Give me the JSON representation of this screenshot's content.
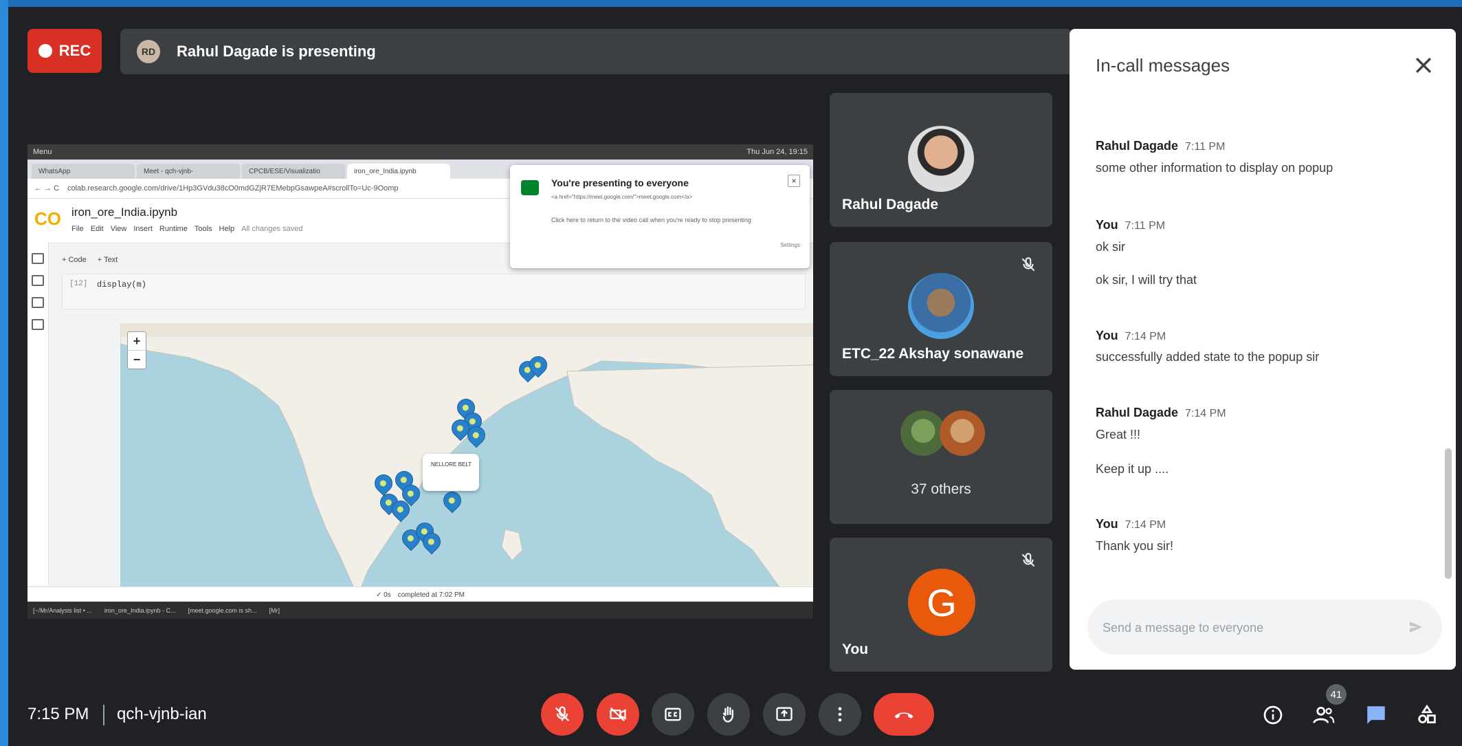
{
  "recording": {
    "label": "REC"
  },
  "presenter_banner": {
    "text": "Rahul Dagade is presenting"
  },
  "shared_screen": {
    "os_menu": "Menu",
    "clock": "Thu Jun 24, 19:15",
    "tabs": [
      "WhatsApp",
      "Meet - qch-vjnb-",
      "CPCB/ESE/Visualizatio",
      "iron_ore_India.ipynb"
    ],
    "address": "colab.research.google.com/drive/1Hp3GVdu38cO0mdGZjR7EMebpGsawpeA#scrollTo=Uc-9Oomp",
    "notebook_name": "iron_ore_India.ipynb",
    "menu": [
      "File",
      "Edit",
      "View",
      "Insert",
      "Runtime",
      "Tools",
      "Help"
    ],
    "saved_status": "All changes saved",
    "toolbar": [
      "+ Code",
      "+ Text"
    ],
    "cell_number": "[12]",
    "cell_code": "display(m)",
    "popup_text": "NELLORE BELT",
    "notification": {
      "title": "You're presenting to everyone",
      "line": "<a href=\"https://meet.google.com/\">meet.google.com</a>",
      "body": "Click here to return to the video call when you're ready to stop presenting",
      "settings": "Settings"
    },
    "status": {
      "check": "✓ 0s",
      "completed": "completed at 7:02 PM"
    },
    "taskbar": [
      "[~/Mr/Analysis list • ...",
      "iron_ore_India.ipynb - C...",
      "[meet.google.com is sh...",
      "[Mr]"
    ]
  },
  "participants": [
    {
      "name": "Rahul Dagade",
      "muted": false
    },
    {
      "name": "ETC_22 Akshay sonawane",
      "muted": true
    },
    {
      "name": "37 others",
      "muted": false
    },
    {
      "name": "You",
      "initial": "G",
      "muted": true
    }
  ],
  "chat": {
    "title": "In-call messages",
    "messages": [
      {
        "sender": "Rahul Dagade",
        "time": "7:11 PM",
        "lines": [
          "some other information to display on popup"
        ]
      },
      {
        "sender": "You",
        "time": "7:11 PM",
        "lines": [
          "ok sir",
          "ok sir, I will try that"
        ]
      },
      {
        "sender": "You",
        "time": "7:14 PM",
        "lines": [
          "successfully added state to the popup sir"
        ]
      },
      {
        "sender": "Rahul Dagade",
        "time": "7:14 PM",
        "lines": [
          "Great !!!",
          "Keep it up ...."
        ]
      },
      {
        "sender": "You",
        "time": "7:14 PM",
        "lines": [
          "Thank you sir!"
        ]
      }
    ],
    "input_placeholder": "Send a message to everyone"
  },
  "bottom_bar": {
    "time": "7:15 PM",
    "meeting_code": "qch-vjnb-ian",
    "participant_count": "41"
  },
  "colors": {
    "accent_red": "#ea4335",
    "meet_dark": "#202124",
    "tile": "#3c4043",
    "chat_blue": "#8ab4f8"
  },
  "icons": [
    "mic-off-icon",
    "camera-off-icon",
    "captions-icon",
    "raise-hand-icon",
    "present-icon",
    "more-options-icon",
    "end-call-icon",
    "info-icon",
    "people-icon",
    "chat-icon",
    "activities-icon"
  ]
}
